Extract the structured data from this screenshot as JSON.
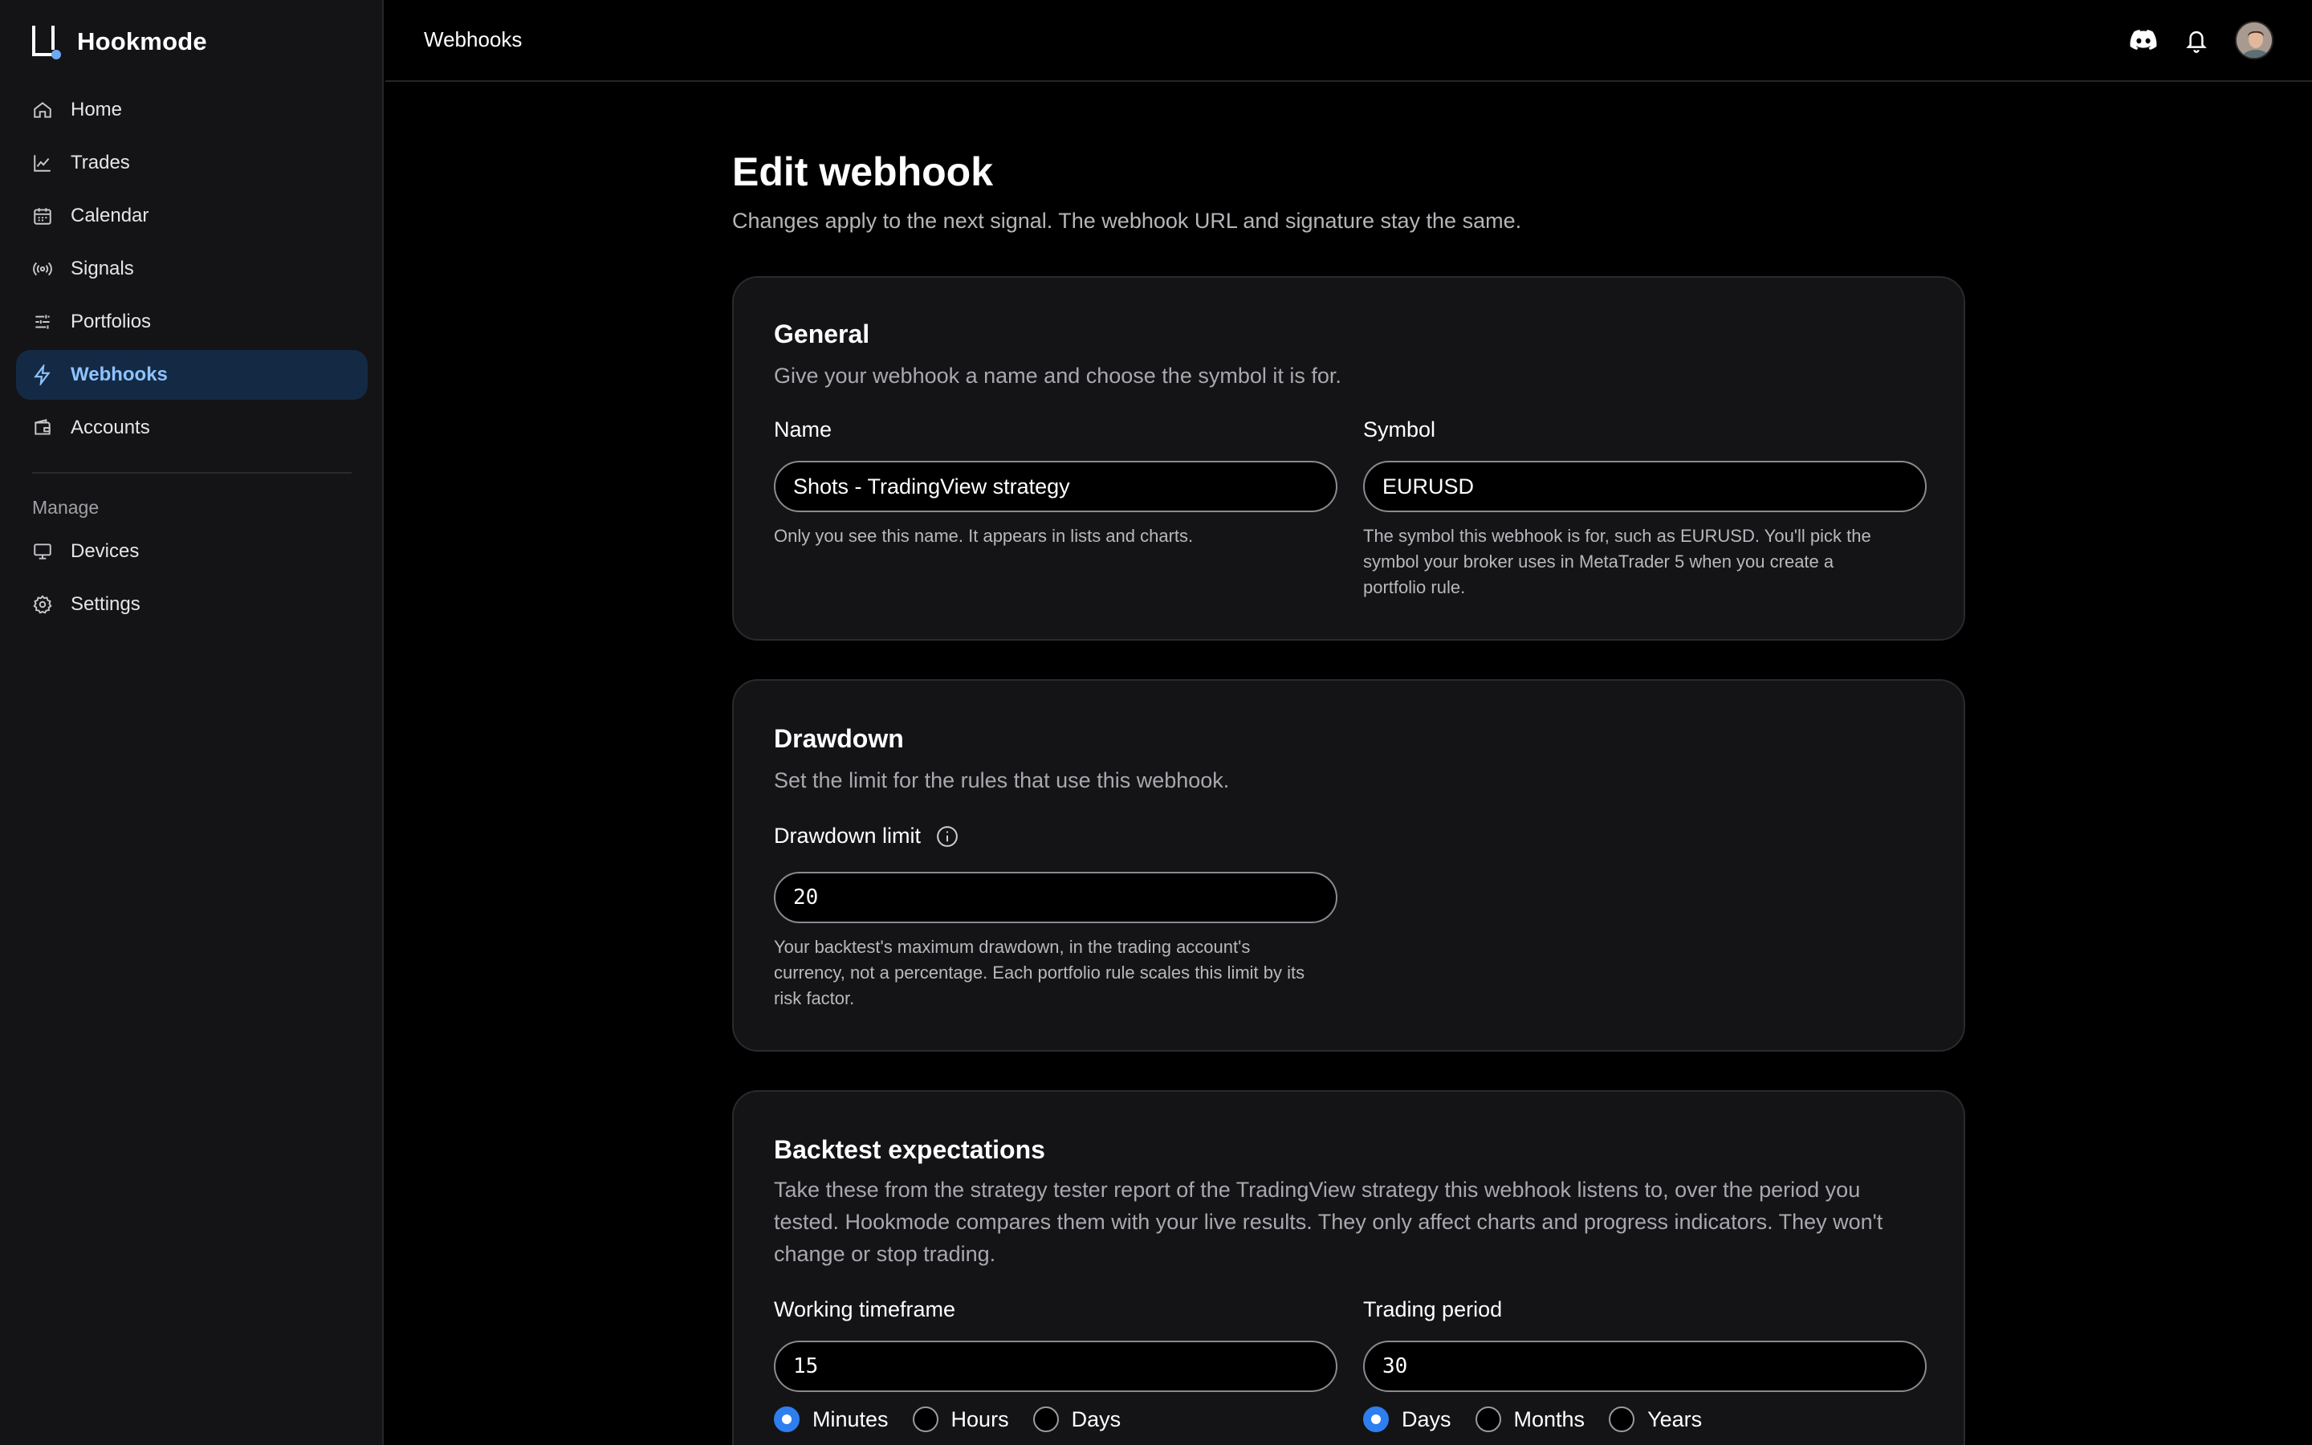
{
  "app": {
    "name": "Hookmode",
    "accent": "#8ec3ff",
    "active_bg": "#142a44"
  },
  "sidebar": {
    "items": [
      {
        "label": "Home",
        "icon": "home-icon"
      },
      {
        "label": "Trades",
        "icon": "chart-line-icon"
      },
      {
        "label": "Calendar",
        "icon": "calendar-icon"
      },
      {
        "label": "Signals",
        "icon": "broadcast-icon"
      },
      {
        "label": "Portfolios",
        "icon": "sliders-icon"
      },
      {
        "label": "Webhooks",
        "icon": "bolt-icon",
        "active": true
      },
      {
        "label": "Accounts",
        "icon": "wallet-icon"
      }
    ],
    "manage_label": "Manage",
    "manage_items": [
      {
        "label": "Devices",
        "icon": "monitor-icon"
      },
      {
        "label": "Settings",
        "icon": "gear-icon"
      }
    ]
  },
  "header": {
    "title": "Webhooks",
    "icons": [
      "discord-icon",
      "bell-icon",
      "avatar"
    ]
  },
  "page": {
    "title": "Edit webhook",
    "subtitle": "Changes apply to the next signal. The webhook URL and signature stay the same."
  },
  "general": {
    "title": "General",
    "description": "Give your webhook a name and choose the symbol it is for.",
    "name_label": "Name",
    "name_value": "Shots - TradingView strategy",
    "name_help": "Only you see this name. It appears in lists and charts.",
    "symbol_label": "Symbol",
    "symbol_value": "EURUSD",
    "symbol_help_1": "The symbol this webhook is for, such as EURUSD. You'll pick the",
    "symbol_help_2": "symbol your broker uses in MetaTrader 5 when you create a",
    "symbol_help_3": "portfolio rule."
  },
  "drawdown": {
    "title": "Drawdown",
    "description": "Set the limit for the rules that use this webhook.",
    "limit_label": "Drawdown limit",
    "limit_value": "20",
    "help_1": "Your backtest's maximum drawdown, in the trading account's",
    "help_2": "currency, not a percentage. Each portfolio rule scales this limit by its",
    "help_3": "risk factor."
  },
  "backtest": {
    "title": "Backtest expectations",
    "description_1": "Take these from the strategy tester report of the TradingView strategy this webhook listens to, over the period you",
    "description_2": "tested. Hookmode compares them with your live results. They only affect charts and progress indicators. They won't",
    "description_3": "change or stop trading.",
    "timeframe_label": "Working timeframe",
    "timeframe_value": "15",
    "timeframe_units": [
      "Minutes",
      "Hours",
      "Days"
    ],
    "timeframe_selected": "Minutes",
    "period_label": "Trading period",
    "period_value": "30",
    "period_units": [
      "Days",
      "Months",
      "Years"
    ],
    "period_selected": "Days"
  }
}
